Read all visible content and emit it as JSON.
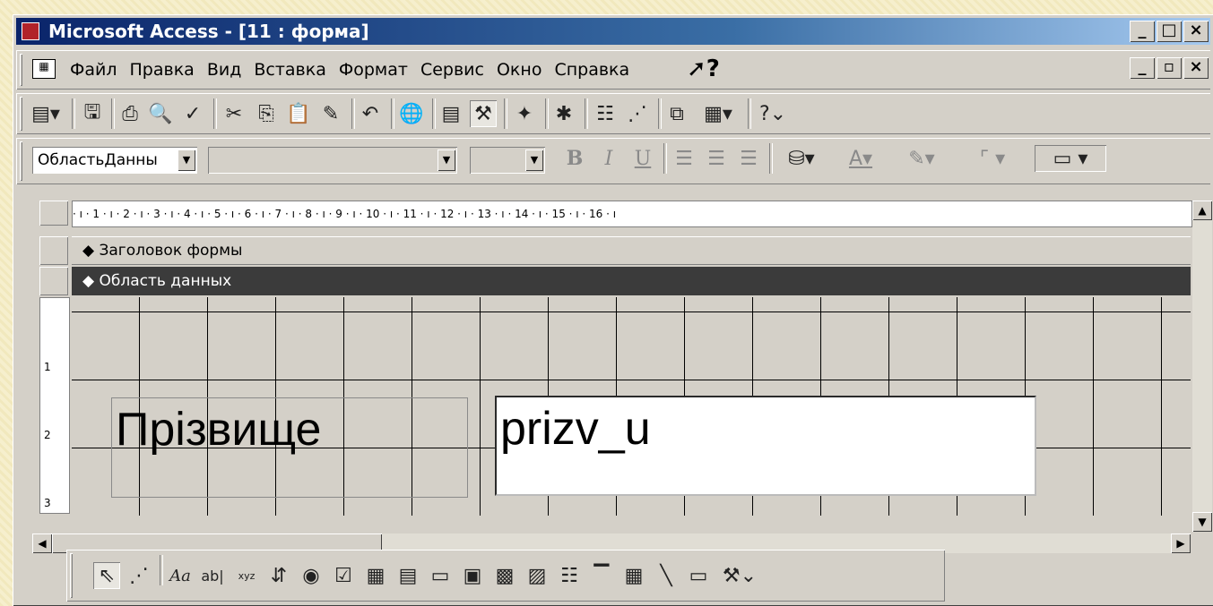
{
  "window": {
    "title": "Microsoft Access - [11 : форма]",
    "controls": [
      "_",
      "□",
      "×"
    ]
  },
  "menubar": {
    "items": [
      {
        "label": "Файл"
      },
      {
        "label": "Правка"
      },
      {
        "label": "Вид"
      },
      {
        "label": "Вставка"
      },
      {
        "label": "Формат"
      },
      {
        "label": "Сервис"
      },
      {
        "label": "Окно"
      },
      {
        "label": "Справка"
      }
    ],
    "help_symbol": "?",
    "doc_controls": [
      "_",
      "▫",
      "×"
    ]
  },
  "toolbar_formatting": {
    "object_combo": "ОбластьДанны",
    "font_combo": "",
    "size_combo": "",
    "bold": "B",
    "italic": "I",
    "underline": "U",
    "fill_letter": "A"
  },
  "ruler": {
    "text": "· ı · 1 · ı · 2 · ı · 3 · ı · 4 · ı · 5 · ı · 6 · ı · 7 · ı · 8 · ı · 9 · ı · 10 · ı · 11 · ı · 12 · ı · 13 · ı · 14 · ı · 15 · ı · 16 · ı"
  },
  "vertical_ruler": {
    "marks": [
      "1",
      "2",
      "3"
    ]
  },
  "sections": {
    "form_header": "Заголовок формы",
    "detail": "Область данных"
  },
  "controls": {
    "label_text": "Прізвище",
    "field_text": "prizv_u"
  },
  "toolbox": {
    "font_tool_label": "Aa",
    "textbox_tool_label": "ab|",
    "option_tool_label": "xyz"
  }
}
